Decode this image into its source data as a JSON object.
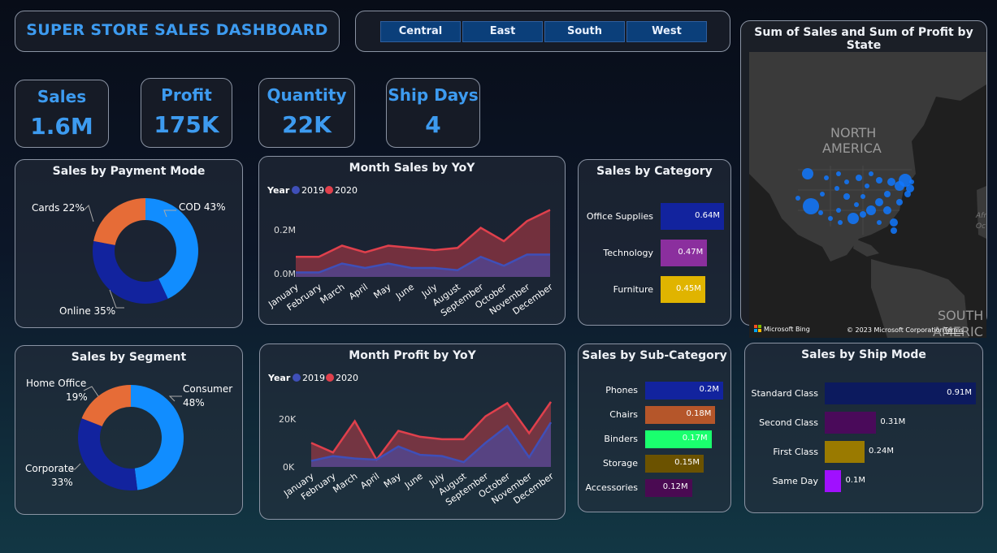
{
  "header": {
    "title": "SUPER STORE SALES DASHBOARD"
  },
  "region_filter": {
    "buttons": [
      "Central",
      "East",
      "South",
      "West"
    ]
  },
  "kpis": [
    {
      "label": "Sales",
      "value": "1.6M"
    },
    {
      "label": "Profit",
      "value": "175K"
    },
    {
      "label": "Quantity",
      "value": "22K"
    },
    {
      "label": "Ship Days",
      "value": "4"
    }
  ],
  "colors": {
    "accent": "#3d9bf0",
    "series_2019": "#3f4fb8",
    "series_2020": "#e0404c",
    "donut_blue": "#118dff",
    "donut_navy": "#12239e",
    "donut_orange": "#e66c37"
  },
  "payment_mode": {
    "title": "Sales by Payment Mode",
    "labels": {
      "cod": "COD 43%",
      "online": "Online 35%",
      "cards": "Cards 22%"
    }
  },
  "segment": {
    "title": "Sales by Segment",
    "labels": {
      "consumer": "Consumer",
      "consumer_pct": "48%",
      "corporate": "Corporate",
      "corporate_pct": "33%",
      "home_office": "Home Office",
      "home_office_pct": "19%"
    }
  },
  "month_sales": {
    "title": "Month Sales by YoY",
    "legend_title": "Year",
    "legend_2019": "2019",
    "legend_2020": "2020",
    "y_ticks": [
      "0.2M",
      "0.0M"
    ]
  },
  "month_profit": {
    "title": "Month Profit by YoY",
    "legend_title": "Year",
    "legend_2019": "2019",
    "legend_2020": "2020",
    "y_ticks": [
      "20K",
      "0K"
    ]
  },
  "months": [
    "January",
    "February",
    "March",
    "April",
    "May",
    "June",
    "July",
    "August",
    "September",
    "October",
    "November",
    "December"
  ],
  "category": {
    "title": "Sales by Category",
    "items": [
      {
        "label": "Office Supplies",
        "value": "0.64M",
        "color": "#12239e"
      },
      {
        "label": "Technology",
        "value": "0.47M",
        "color": "#8b2f9e"
      },
      {
        "label": "Furniture",
        "value": "0.45M",
        "color": "#e0b400"
      }
    ]
  },
  "sub_category": {
    "title": "Sales by Sub-Category",
    "items": [
      {
        "label": "Phones",
        "value": "0.2M",
        "color": "#12239e"
      },
      {
        "label": "Chairs",
        "value": "0.18M",
        "color": "#b5562a"
      },
      {
        "label": "Binders",
        "value": "0.17M",
        "color": "#1aff6e"
      },
      {
        "label": "Storage",
        "value": "0.15M",
        "color": "#6b5200"
      },
      {
        "label": "Accessories",
        "value": "0.12M",
        "color": "#4a0a52"
      }
    ]
  },
  "ship_mode": {
    "title": "Sales by Ship Mode",
    "items": [
      {
        "label": "Standard Class",
        "value": "0.91M",
        "color": "#0c1a5e"
      },
      {
        "label": "Second Class",
        "value": "0.31M",
        "color": "#4a0a5a"
      },
      {
        "label": "First Class",
        "value": "0.24M",
        "color": "#9a7a00"
      },
      {
        "label": "Same Day",
        "value": "0.1M",
        "color": "#a010ff"
      }
    ]
  },
  "map": {
    "title": "Sum of Sales and Sum of Profit by State",
    "label_north": "NORTH",
    "label_america": "AMERICA",
    "label_south": "SOUTH",
    "label_america2": "AMERIC",
    "label_afr": "Afr",
    "label_oc": "Oc",
    "attribution_brand": "Microsoft Bing",
    "copyright": "© 2023 Microsoft Corporation",
    "terms": "Terms"
  },
  "chart_data": [
    {
      "type": "area",
      "title": "Month Sales by YoY",
      "x": [
        "January",
        "February",
        "March",
        "April",
        "May",
        "June",
        "July",
        "August",
        "September",
        "October",
        "November",
        "December"
      ],
      "series": [
        {
          "name": "2019",
          "values": [
            0.02,
            0.02,
            0.06,
            0.04,
            0.06,
            0.04,
            0.04,
            0.03,
            0.09,
            0.05,
            0.1,
            0.1
          ]
        },
        {
          "name": "2020",
          "values": [
            0.09,
            0.09,
            0.14,
            0.11,
            0.14,
            0.13,
            0.12,
            0.13,
            0.22,
            0.16,
            0.25,
            0.3
          ]
        }
      ],
      "ylim": [
        0,
        0.32
      ]
    },
    {
      "type": "area",
      "title": "Month Profit by YoY",
      "x": [
        "January",
        "February",
        "March",
        "April",
        "May",
        "June",
        "July",
        "August",
        "September",
        "October",
        "November",
        "December"
      ],
      "series": [
        {
          "name": "2019",
          "values": [
            2.5,
            4.5,
            3.5,
            3,
            8.5,
            5,
            4.5,
            2,
            10,
            17,
            4,
            18.5
          ]
        },
        {
          "name": "2020",
          "values": [
            10,
            6,
            19,
            3,
            15,
            12.5,
            11.5,
            11.5,
            21,
            26.5,
            14,
            27
          ]
        }
      ],
      "ylim": [
        0,
        30
      ]
    },
    {
      "type": "pie",
      "title": "Sales by Payment Mode",
      "categories": [
        "COD",
        "Online",
        "Cards"
      ],
      "values": [
        43,
        35,
        22
      ]
    },
    {
      "type": "pie",
      "title": "Sales by Segment",
      "categories": [
        "Consumer",
        "Corporate",
        "Home Office"
      ],
      "values": [
        48,
        33,
        19
      ]
    },
    {
      "type": "bar",
      "title": "Sales by Category",
      "categories": [
        "Office Supplies",
        "Technology",
        "Furniture"
      ],
      "values": [
        0.64,
        0.47,
        0.45
      ]
    },
    {
      "type": "bar",
      "title": "Sales by Sub-Category",
      "categories": [
        "Phones",
        "Chairs",
        "Binders",
        "Storage",
        "Accessories"
      ],
      "values": [
        0.2,
        0.18,
        0.17,
        0.15,
        0.12
      ]
    },
    {
      "type": "bar",
      "title": "Sales by Ship Mode",
      "categories": [
        "Standard Class",
        "Second Class",
        "First Class",
        "Same Day"
      ],
      "values": [
        0.91,
        0.31,
        0.24,
        0.1
      ]
    }
  ]
}
